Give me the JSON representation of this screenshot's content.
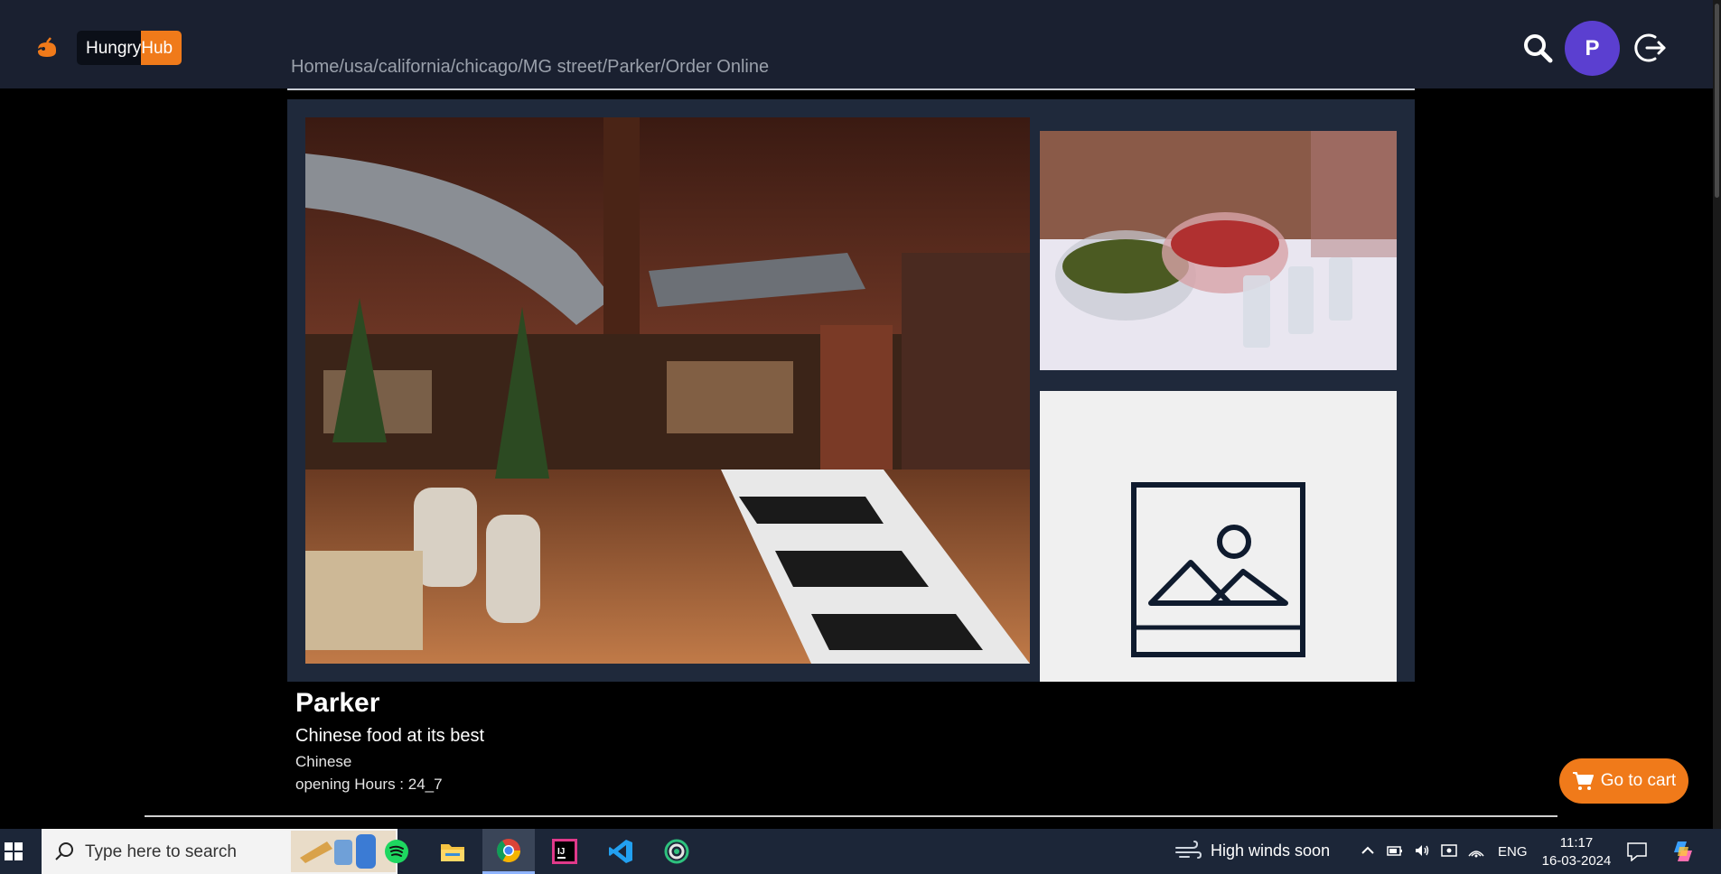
{
  "header": {
    "brand_part1": "Hungry",
    "brand_part2": "Hub",
    "breadcrumb": "Home/usa/california/chicago/MG street/Parker/Order Online",
    "avatar_initial": "P",
    "icons": [
      "logo-icon",
      "search-icon",
      "logout-icon"
    ]
  },
  "restaurant": {
    "name": "Parker",
    "tagline": "Chinese food at its best",
    "cuisine": "Chinese",
    "hours": "opening Hours : 24_7"
  },
  "cart": {
    "label": "Go to cart"
  },
  "taskbar": {
    "search_placeholder": "Type here to search",
    "apps": [
      "spotify",
      "file-explorer",
      "chrome",
      "intellij",
      "vs-code",
      "app-ring"
    ],
    "active_app": "chrome",
    "weather": "High winds soon",
    "language": "ENG",
    "time": "11:17",
    "date": "16-03-2024"
  },
  "colors": {
    "accent": "#f07a1a",
    "header_bg": "#1a2030",
    "gallery_bg": "#1f293b",
    "avatar_bg": "#5b3fd0"
  }
}
